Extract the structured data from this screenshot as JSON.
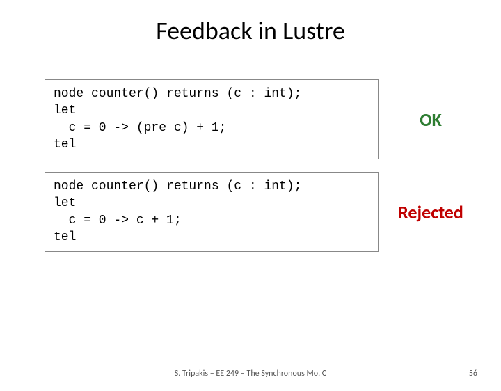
{
  "title": "Feedback in Lustre",
  "examples": [
    {
      "code": "node counter() returns (c : int);\nlet\n  c = 0 -> (pre c) + 1;\ntel",
      "status": "OK",
      "status_class": "ok"
    },
    {
      "code": "node counter() returns (c : int);\nlet\n  c = 0 -> c + 1;\ntel",
      "status": "Rejected",
      "status_class": "rejected"
    }
  ],
  "footer": "S. Tripakis – EE 249 – The Synchronous Mo. C",
  "page_number": "56"
}
